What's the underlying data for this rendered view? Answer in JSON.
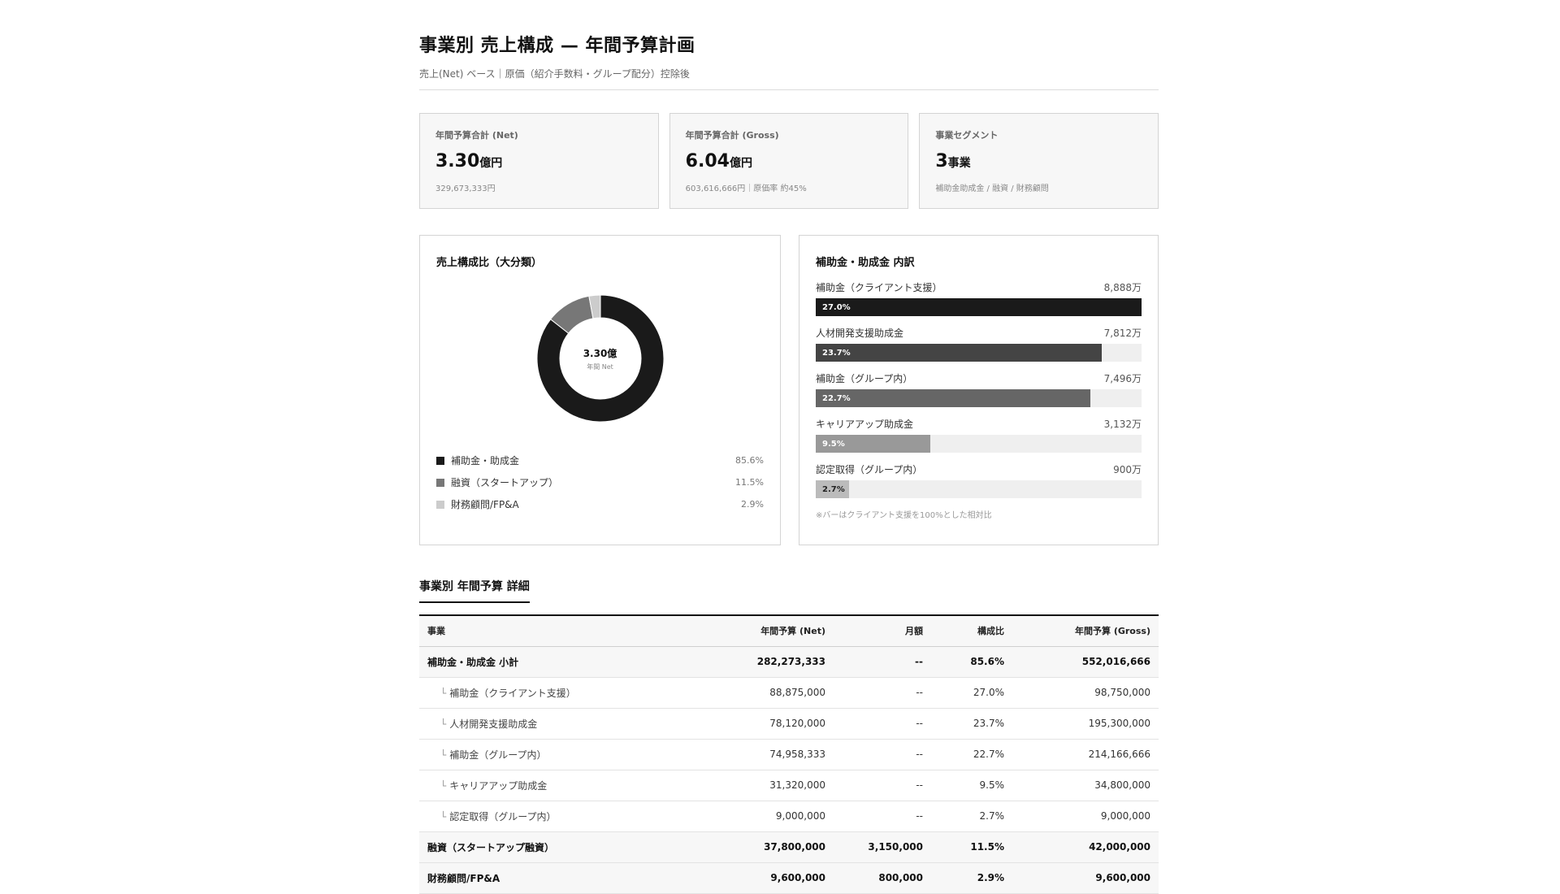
{
  "header": {
    "title": "事業別 売上構成 — 年間予算計画",
    "subtitle": "売上(Net) ベース｜原価（紹介手数料・グループ配分）控除後"
  },
  "kpis": [
    {
      "label": "年間予算合計 (Net)",
      "value": "3.30",
      "unit": "億円",
      "note": "329,673,333円"
    },
    {
      "label": "年間予算合計 (Gross)",
      "value": "6.04",
      "unit": "億円",
      "note": "603,616,666円｜原価率 約45%"
    },
    {
      "label": "事業セグメント",
      "value": "3",
      "unit": "事業",
      "note": "補助金助成金 / 融資 / 財務顧問"
    }
  ],
  "composition": {
    "title": "売上構成比（大分類）",
    "center_value": "3.30億",
    "center_label": "年間 Net",
    "legend": [
      {
        "label": "補助金・助成金",
        "pct": "85.6%",
        "value": 85.6,
        "color": "#1a1a1a"
      },
      {
        "label": "融資（スタートアップ）",
        "pct": "11.5%",
        "value": 11.5,
        "color": "#777777"
      },
      {
        "label": "財務顧問/FP&A",
        "pct": "2.9%",
        "value": 2.9,
        "color": "#cccccc"
      }
    ]
  },
  "breakdown": {
    "title": "補助金・助成金 内訳",
    "note": "※バーはクライアント支援を100%とした相対比",
    "items": [
      {
        "label": "補助金（クライアント支援）",
        "amount": "8,888万",
        "pct_label": "27.0%",
        "relative": 1.0,
        "color": "#1a1a1a",
        "text_color": "#ffffff"
      },
      {
        "label": "人材開発支援助成金",
        "amount": "7,812万",
        "pct_label": "23.7%",
        "relative": 0.879,
        "color": "#444444",
        "text_color": "#ffffff"
      },
      {
        "label": "補助金（グループ内）",
        "amount": "7,496万",
        "pct_label": "22.7%",
        "relative": 0.843,
        "color": "#666666",
        "text_color": "#ffffff"
      },
      {
        "label": "キャリアアップ助成金",
        "amount": "3,132万",
        "pct_label": "9.5%",
        "relative": 0.352,
        "color": "#999999",
        "text_color": "#ffffff"
      },
      {
        "label": "認定取得（グループ内）",
        "amount": "900万",
        "pct_label": "2.7%",
        "relative": 0.101,
        "color": "#bbbbbb",
        "text_color": "#222222"
      }
    ]
  },
  "table": {
    "title": "事業別 年間予算 詳細",
    "headers": [
      "事業",
      "年間予算 (Net)",
      "月額",
      "構成比",
      "年間予算 (Gross)"
    ],
    "rows": [
      {
        "type": "sub",
        "name": "補助金・助成金 小計",
        "net": "282,273,333",
        "monthly": "--",
        "ratio": "85.6%",
        "gross": "552,016,666"
      },
      {
        "type": "child",
        "name": "補助金（クライアント支援）",
        "net": "88,875,000",
        "monthly": "--",
        "ratio": "27.0%",
        "gross": "98,750,000"
      },
      {
        "type": "child",
        "name": "人材開発支援助成金",
        "net": "78,120,000",
        "monthly": "--",
        "ratio": "23.7%",
        "gross": "195,300,000"
      },
      {
        "type": "child",
        "name": "補助金（グループ内）",
        "net": "74,958,333",
        "monthly": "--",
        "ratio": "22.7%",
        "gross": "214,166,666"
      },
      {
        "type": "child",
        "name": "キャリアアップ助成金",
        "net": "31,320,000",
        "monthly": "--",
        "ratio": "9.5%",
        "gross": "34,800,000"
      },
      {
        "type": "child",
        "name": "認定取得（グループ内）",
        "net": "9,000,000",
        "monthly": "--",
        "ratio": "2.7%",
        "gross": "9,000,000"
      },
      {
        "type": "sub",
        "name": "融資（スタートアップ融資）",
        "net": "37,800,000",
        "monthly": "3,150,000",
        "ratio": "11.5%",
        "gross": "42,000,000"
      },
      {
        "type": "sub",
        "name": "財務顧問/FP&A",
        "net": "9,600,000",
        "monthly": "800,000",
        "ratio": "2.9%",
        "gross": "9,600,000"
      }
    ]
  }
}
